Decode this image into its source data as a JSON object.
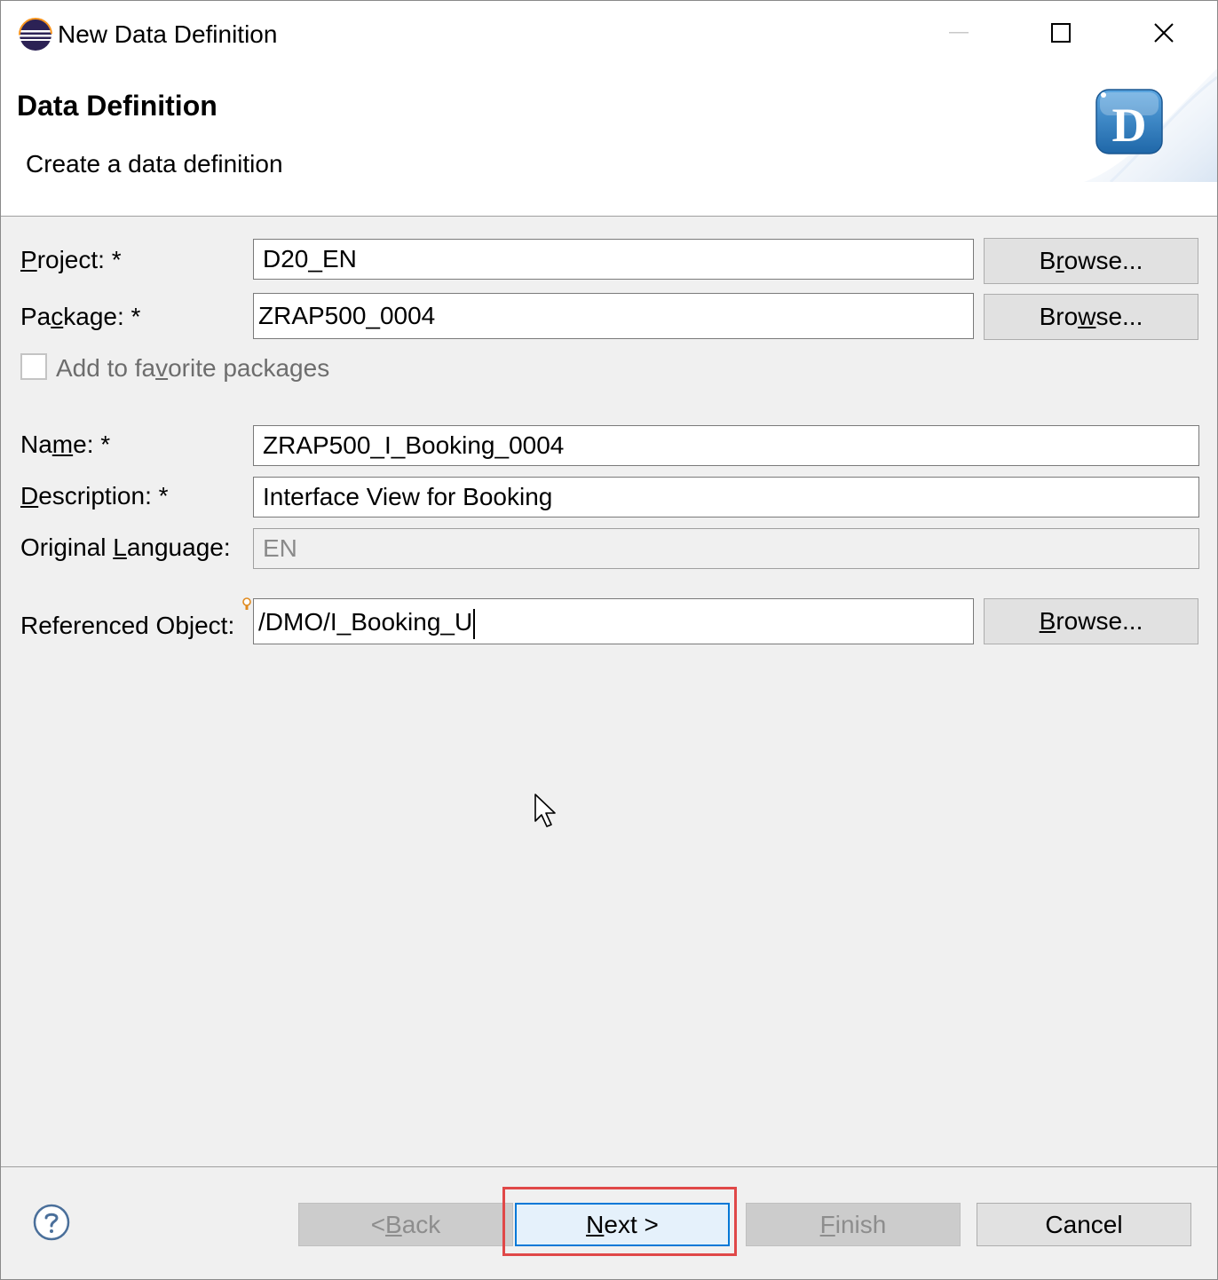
{
  "window": {
    "title": "New Data Definition",
    "icon": "eclipse-icon",
    "controls": [
      "minimize-icon",
      "maximize-icon",
      "close-icon"
    ]
  },
  "banner": {
    "title": "Data Definition",
    "description": "Create a data definition",
    "logo_letter": "D"
  },
  "form": {
    "project": {
      "label_pre": "",
      "label_u": "P",
      "label_post": "roject: *",
      "value": "D20_EN",
      "browse": {
        "pre": "B",
        "u": "r",
        "post": "owse..."
      }
    },
    "package": {
      "label_pre": "Pa",
      "label_u": "c",
      "label_post": "kage: *",
      "value": "ZRAP500_0004",
      "browse": {
        "pre": "Bro",
        "u": "w",
        "post": "se..."
      }
    },
    "favorite": {
      "label_pre": "Add to fa",
      "label_u": "v",
      "label_post": "orite packages",
      "checked": false,
      "enabled": false
    },
    "name": {
      "label_pre": "Na",
      "label_u": "m",
      "label_post": "e: *",
      "value": "ZRAP500_I_Booking_0004"
    },
    "description": {
      "label_pre": "",
      "label_u": "D",
      "label_post": "escription: *",
      "value": "Interface View for Booking"
    },
    "original_language": {
      "label_pre": "Original ",
      "label_u": "L",
      "label_post": "anguage:",
      "value": "EN"
    },
    "referenced_object": {
      "label": "Referenced Object:",
      "value": "/DMO/I_Booking_U",
      "browse": {
        "pre": "",
        "u": "B",
        "post": "rowse..."
      }
    }
  },
  "footer": {
    "help_icon": "help-icon",
    "back": {
      "pre": "< ",
      "u": "B",
      "post": "ack",
      "enabled": false
    },
    "next": {
      "pre": "",
      "u": "N",
      "post": "ext >",
      "enabled": true
    },
    "finish": {
      "pre": "",
      "u": "F",
      "post": "inish",
      "enabled": false
    },
    "cancel": "Cancel"
  },
  "colors": {
    "highlight": "#e04848",
    "focus": "#0078d7",
    "dialog_bg": "#f0f0f0",
    "logo_blue": "#2f7ec1"
  }
}
